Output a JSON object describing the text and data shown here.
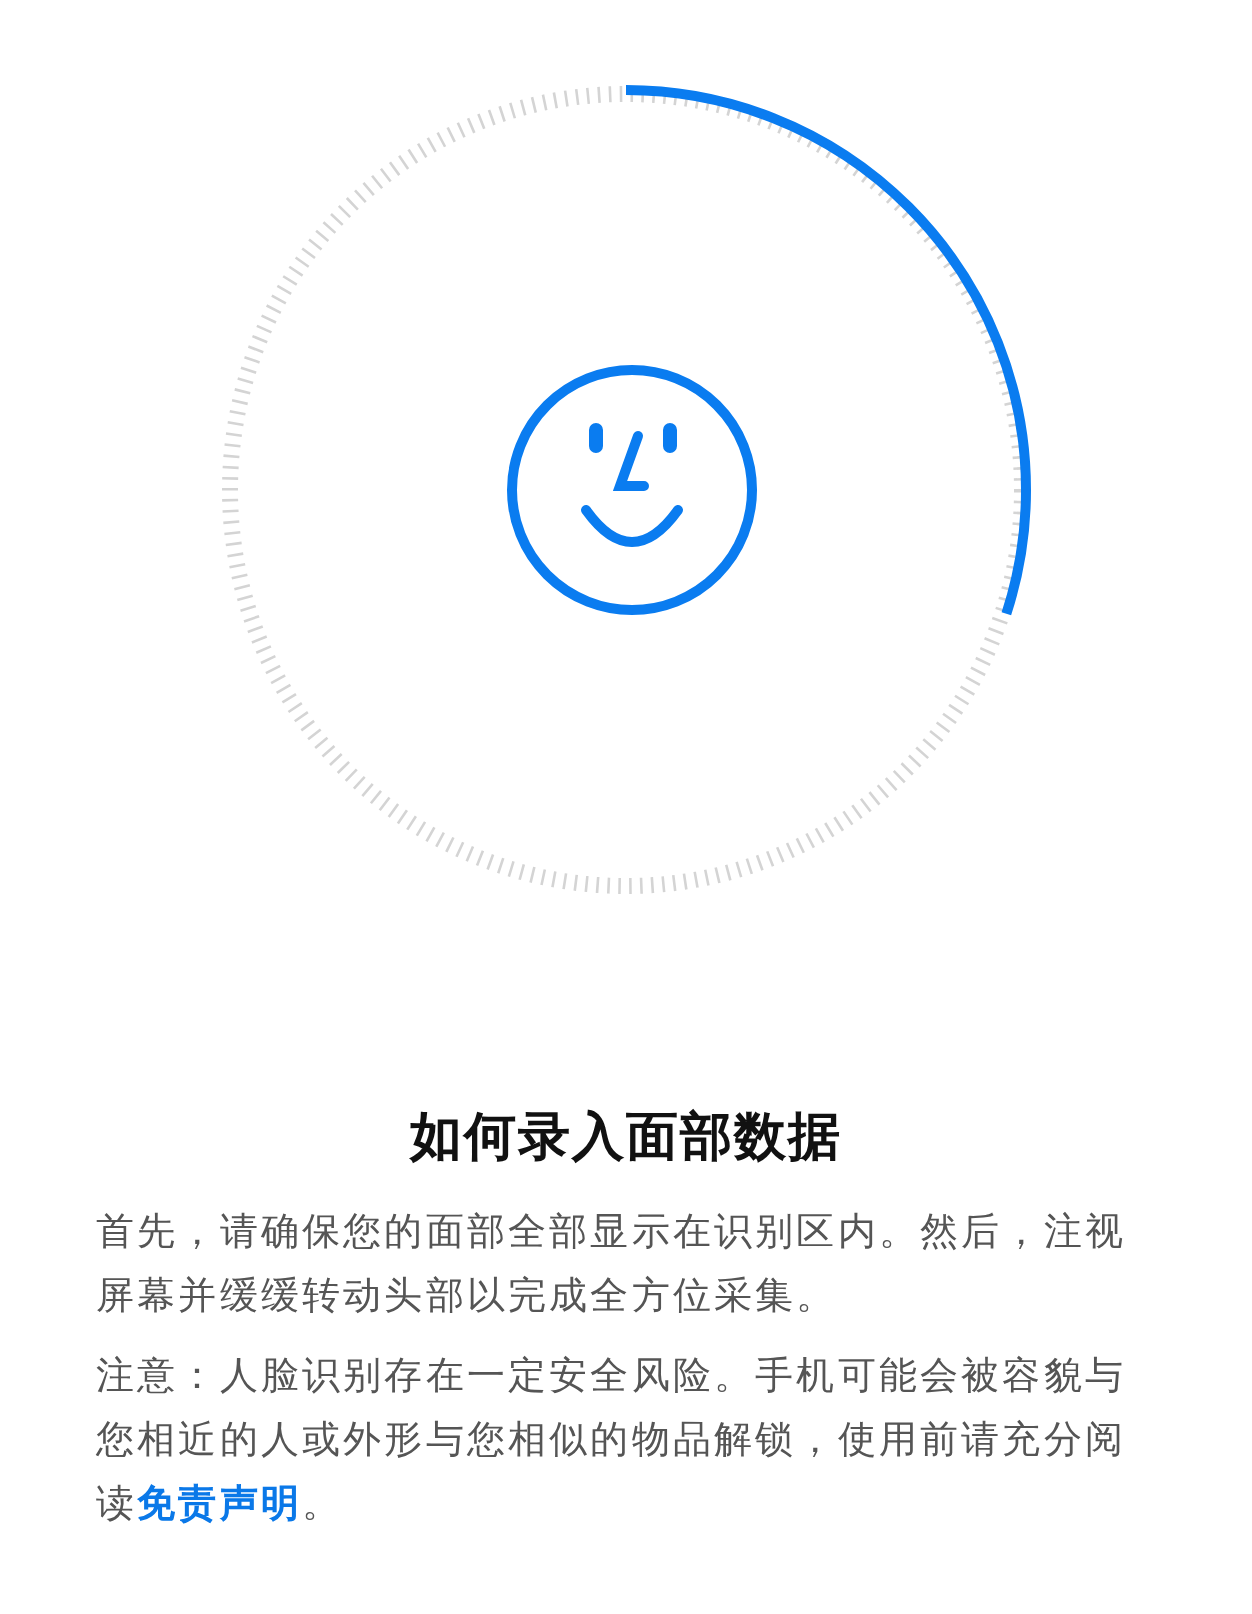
{
  "title": "如何录入面部数据",
  "paragraphs": [
    {
      "text": "首先，请确保您的面部全部显示在识别区内。然后，注视屏幕并缓缓转动头部以完成全方位采集。"
    },
    {
      "text": "注意：人脸识别存在一定安全风险。手机可能会被容貌与您相近的人或外形与您相似的物品解锁，使用前请充分阅读",
      "link": "免责声明",
      "suffix": "。"
    }
  ]
}
